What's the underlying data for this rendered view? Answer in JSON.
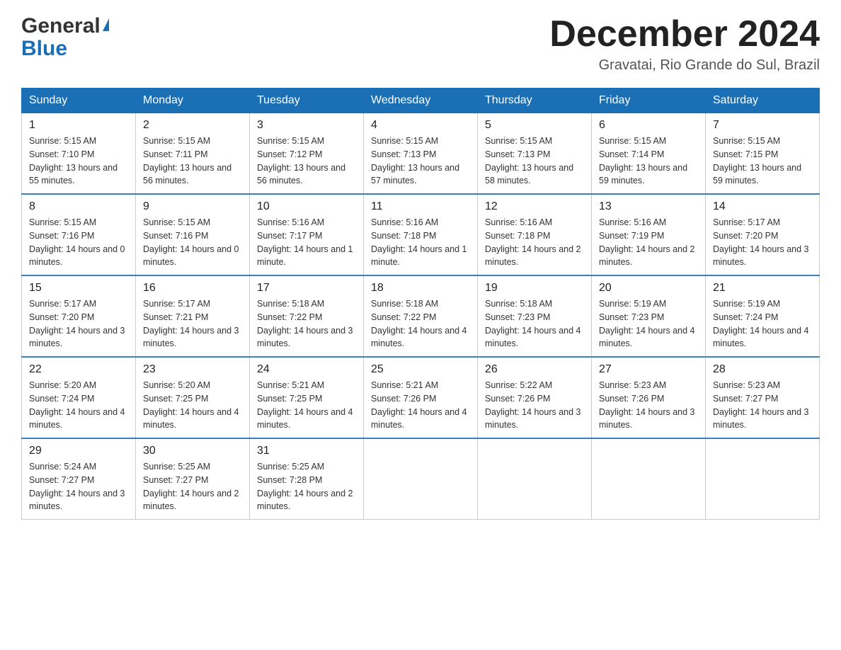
{
  "header": {
    "logo_general": "General",
    "logo_blue": "Blue",
    "month_title": "December 2024",
    "location": "Gravatai, Rio Grande do Sul, Brazil"
  },
  "days_of_week": [
    "Sunday",
    "Monday",
    "Tuesday",
    "Wednesday",
    "Thursday",
    "Friday",
    "Saturday"
  ],
  "weeks": [
    [
      {
        "day": "1",
        "sunrise": "5:15 AM",
        "sunset": "7:10 PM",
        "daylight": "13 hours and 55 minutes."
      },
      {
        "day": "2",
        "sunrise": "5:15 AM",
        "sunset": "7:11 PM",
        "daylight": "13 hours and 56 minutes."
      },
      {
        "day": "3",
        "sunrise": "5:15 AM",
        "sunset": "7:12 PM",
        "daylight": "13 hours and 56 minutes."
      },
      {
        "day": "4",
        "sunrise": "5:15 AM",
        "sunset": "7:13 PM",
        "daylight": "13 hours and 57 minutes."
      },
      {
        "day": "5",
        "sunrise": "5:15 AM",
        "sunset": "7:13 PM",
        "daylight": "13 hours and 58 minutes."
      },
      {
        "day": "6",
        "sunrise": "5:15 AM",
        "sunset": "7:14 PM",
        "daylight": "13 hours and 59 minutes."
      },
      {
        "day": "7",
        "sunrise": "5:15 AM",
        "sunset": "7:15 PM",
        "daylight": "13 hours and 59 minutes."
      }
    ],
    [
      {
        "day": "8",
        "sunrise": "5:15 AM",
        "sunset": "7:16 PM",
        "daylight": "14 hours and 0 minutes."
      },
      {
        "day": "9",
        "sunrise": "5:15 AM",
        "sunset": "7:16 PM",
        "daylight": "14 hours and 0 minutes."
      },
      {
        "day": "10",
        "sunrise": "5:16 AM",
        "sunset": "7:17 PM",
        "daylight": "14 hours and 1 minute."
      },
      {
        "day": "11",
        "sunrise": "5:16 AM",
        "sunset": "7:18 PM",
        "daylight": "14 hours and 1 minute."
      },
      {
        "day": "12",
        "sunrise": "5:16 AM",
        "sunset": "7:18 PM",
        "daylight": "14 hours and 2 minutes."
      },
      {
        "day": "13",
        "sunrise": "5:16 AM",
        "sunset": "7:19 PM",
        "daylight": "14 hours and 2 minutes."
      },
      {
        "day": "14",
        "sunrise": "5:17 AM",
        "sunset": "7:20 PM",
        "daylight": "14 hours and 3 minutes."
      }
    ],
    [
      {
        "day": "15",
        "sunrise": "5:17 AM",
        "sunset": "7:20 PM",
        "daylight": "14 hours and 3 minutes."
      },
      {
        "day": "16",
        "sunrise": "5:17 AM",
        "sunset": "7:21 PM",
        "daylight": "14 hours and 3 minutes."
      },
      {
        "day": "17",
        "sunrise": "5:18 AM",
        "sunset": "7:22 PM",
        "daylight": "14 hours and 3 minutes."
      },
      {
        "day": "18",
        "sunrise": "5:18 AM",
        "sunset": "7:22 PM",
        "daylight": "14 hours and 4 minutes."
      },
      {
        "day": "19",
        "sunrise": "5:18 AM",
        "sunset": "7:23 PM",
        "daylight": "14 hours and 4 minutes."
      },
      {
        "day": "20",
        "sunrise": "5:19 AM",
        "sunset": "7:23 PM",
        "daylight": "14 hours and 4 minutes."
      },
      {
        "day": "21",
        "sunrise": "5:19 AM",
        "sunset": "7:24 PM",
        "daylight": "14 hours and 4 minutes."
      }
    ],
    [
      {
        "day": "22",
        "sunrise": "5:20 AM",
        "sunset": "7:24 PM",
        "daylight": "14 hours and 4 minutes."
      },
      {
        "day": "23",
        "sunrise": "5:20 AM",
        "sunset": "7:25 PM",
        "daylight": "14 hours and 4 minutes."
      },
      {
        "day": "24",
        "sunrise": "5:21 AM",
        "sunset": "7:25 PM",
        "daylight": "14 hours and 4 minutes."
      },
      {
        "day": "25",
        "sunrise": "5:21 AM",
        "sunset": "7:26 PM",
        "daylight": "14 hours and 4 minutes."
      },
      {
        "day": "26",
        "sunrise": "5:22 AM",
        "sunset": "7:26 PM",
        "daylight": "14 hours and 3 minutes."
      },
      {
        "day": "27",
        "sunrise": "5:23 AM",
        "sunset": "7:26 PM",
        "daylight": "14 hours and 3 minutes."
      },
      {
        "day": "28",
        "sunrise": "5:23 AM",
        "sunset": "7:27 PM",
        "daylight": "14 hours and 3 minutes."
      }
    ],
    [
      {
        "day": "29",
        "sunrise": "5:24 AM",
        "sunset": "7:27 PM",
        "daylight": "14 hours and 3 minutes."
      },
      {
        "day": "30",
        "sunrise": "5:25 AM",
        "sunset": "7:27 PM",
        "daylight": "14 hours and 2 minutes."
      },
      {
        "day": "31",
        "sunrise": "5:25 AM",
        "sunset": "7:28 PM",
        "daylight": "14 hours and 2 minutes."
      },
      null,
      null,
      null,
      null
    ]
  ],
  "labels": {
    "sunrise": "Sunrise:",
    "sunset": "Sunset:",
    "daylight": "Daylight:"
  }
}
